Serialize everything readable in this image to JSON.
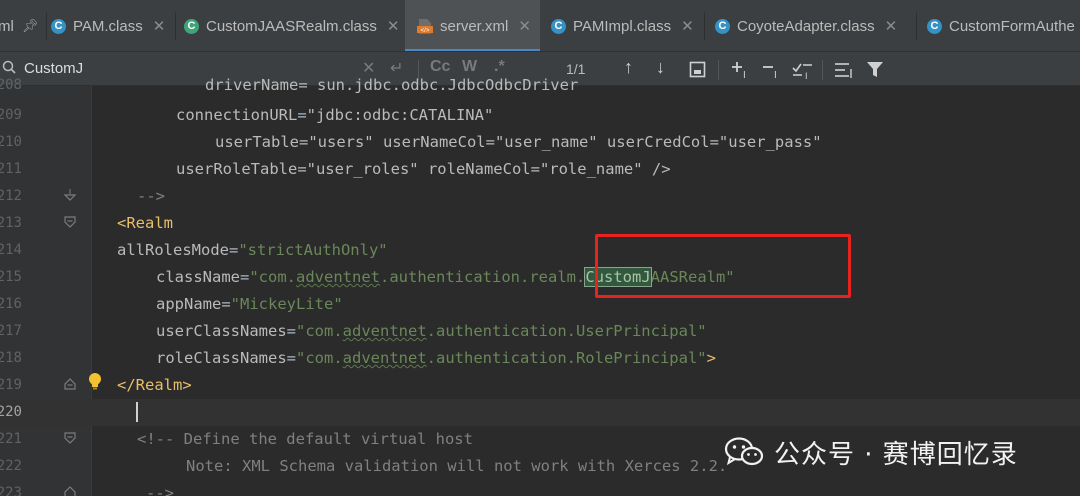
{
  "tabs": [
    {
      "label": "ml",
      "icon": "pin-icon",
      "pinned": true
    },
    {
      "label": "PAM.class",
      "icon": "class-icon",
      "closable": true
    },
    {
      "label": "CustomJAASRealm.class",
      "icon": "class-icon",
      "closable": true
    },
    {
      "label": "server.xml",
      "icon": "xml-file-icon",
      "closable": true,
      "active": true
    },
    {
      "label": "PAMImpl.class",
      "icon": "class-icon",
      "closable": true
    },
    {
      "label": "CoyoteAdapter.class",
      "icon": "class-icon",
      "closable": true
    },
    {
      "label": "CustomFormAuthe",
      "icon": "class-icon"
    }
  ],
  "search": {
    "value": "CustomJ",
    "match_count": "1/1",
    "match_case_label": "Cc",
    "words_label": "W",
    "regex_label": ".*"
  },
  "editor": {
    "lines": [
      {
        "num": "208",
        "text": "driverName= sun.jdbc.odbc.JdbcOdbcDriver"
      },
      {
        "num": "209",
        "attr": "connectionURL",
        "val": "\"jdbc:odbc:CATALINA\""
      },
      {
        "num": "210",
        "text": "userTable=\"users\" userNameCol=\"user_name\" userCredCol=\"user_pass\""
      },
      {
        "num": "211",
        "text": "userRoleTable=\"user_roles\" roleNameCol=\"role_name\" />"
      },
      {
        "num": "212",
        "text": "-->"
      },
      {
        "num": "213",
        "text": "<Realm"
      },
      {
        "num": "214",
        "attr": "allRolesMode",
        "val": "\"strictAuthOnly\""
      },
      {
        "num": "215",
        "attr": "className",
        "val_pre": "\"com.",
        "val_ul1": "adventnet",
        "val_mid": ".authentication.realm.",
        "val_match": "CustomJ",
        "val_post": "AASRealm\""
      },
      {
        "num": "216",
        "attr": "appName",
        "val": "\"MickeyLite\""
      },
      {
        "num": "217",
        "attr": "userClassNames",
        "val_pre": "\"com.",
        "val_ul1": "adventnet",
        "val_post": ".authentication.UserPrincipal\""
      },
      {
        "num": "218",
        "attr": "roleClassNames",
        "val_pre": "\"com.",
        "val_ul1": "adventnet",
        "val_post": ".authentication.RolePrincipal\"",
        "tail": ">"
      },
      {
        "num": "219",
        "text": "</Realm>"
      },
      {
        "num": "220",
        "text": ""
      },
      {
        "num": "221",
        "text": "<!-- Define the default virtual host"
      },
      {
        "num": "222",
        "text": "Note: XML Schema validation will not work with Xerces 2.2."
      },
      {
        "num": "223",
        "text": "-->"
      }
    ]
  },
  "watermark": {
    "text": "公众号 · 赛博回忆录",
    "icon": "wechat-icon"
  },
  "colors": {
    "background": "#2b2b2b",
    "gutter": "#313335",
    "tab_accent": "#4a88c7",
    "xml_tag": "#e8bf6a",
    "xml_value": "#6a8759",
    "xml_attribute": "#bababa",
    "comment": "#808080",
    "search_match": "#32593d",
    "annotation_box": "#e8231d"
  }
}
